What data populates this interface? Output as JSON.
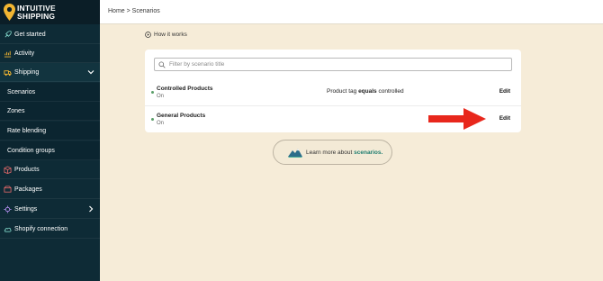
{
  "brand": {
    "line1": "INTUITIVE",
    "line2": "SHIPPING",
    "pin_color": "#f2b632"
  },
  "breadcrumb": "Home > Scenarios",
  "sidebar": {
    "items": [
      {
        "label": "Get started",
        "icon": "rocket-icon"
      },
      {
        "label": "Activity",
        "icon": "chart-icon"
      },
      {
        "label": "Shipping",
        "icon": "truck-icon"
      },
      {
        "label": "Scenarios"
      },
      {
        "label": "Zones"
      },
      {
        "label": "Rate blending"
      },
      {
        "label": "Condition groups"
      },
      {
        "label": "Products",
        "icon": "box-icon"
      },
      {
        "label": "Packages",
        "icon": "package-icon"
      },
      {
        "label": "Settings",
        "icon": "gear-icon"
      },
      {
        "label": "Shopify connection",
        "icon": "cloud-icon"
      }
    ]
  },
  "how_it_works": "How it works",
  "search": {
    "placeholder": "Filter by scenario title"
  },
  "scenarios": [
    {
      "title": "Controlled Products",
      "status": "On",
      "condition_prefix": "Product tag ",
      "condition_op": "equals",
      "condition_suffix": " controlled",
      "edit": "Edit"
    },
    {
      "title": "General Products",
      "status": "On",
      "edit": "Edit"
    }
  ],
  "learn_more": {
    "text": "Learn more about ",
    "link": "scenarios."
  },
  "colors": {
    "sidebar": "#0e2b36",
    "background": "#f6ecd8",
    "arrow": "#e8271c",
    "status_on": "#5a9e68",
    "link": "#1e7d6f"
  }
}
